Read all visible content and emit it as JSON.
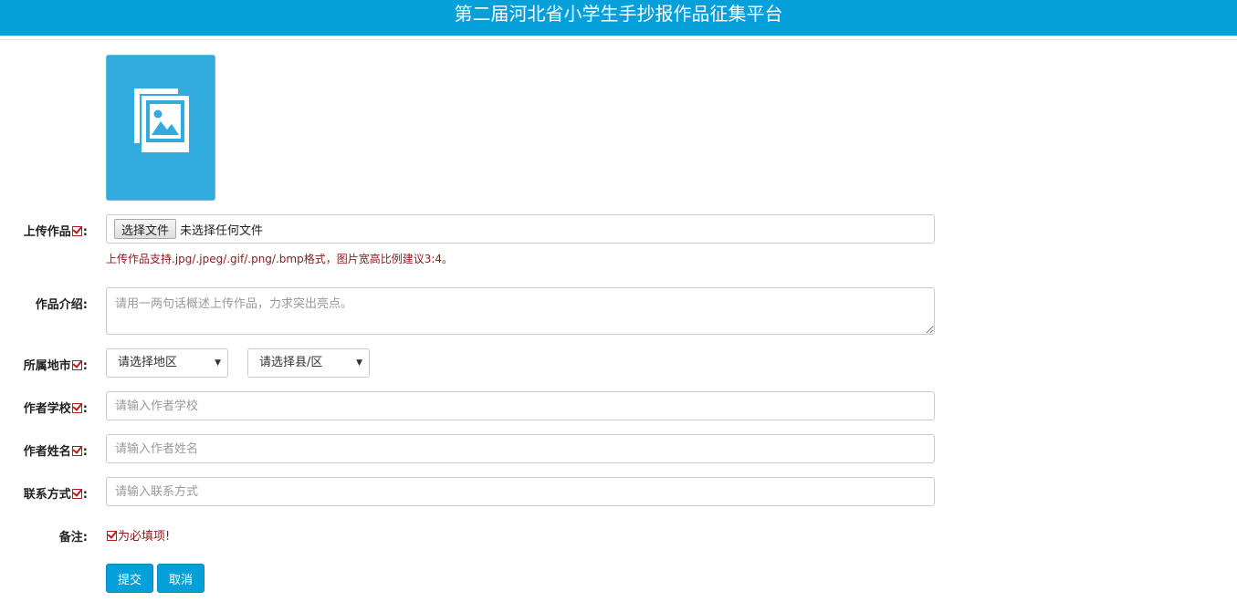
{
  "header": {
    "title": "第二届河北省小学生手抄报作品征集平台"
  },
  "colors": {
    "header": "#059fd9",
    "preview": "#32acdf",
    "required": "#b71c1c",
    "button": "#059fd9"
  },
  "preview": {
    "icon": "image-placeholder-icon"
  },
  "form": {
    "upload": {
      "label": "上传作品",
      "colon": ":",
      "button_label": "选择文件",
      "status": "未选择任何文件",
      "hint": "上传作品支持.jpg/.jpeg/.gif/.png/.bmp格式，图片宽高比例建议3:4。"
    },
    "intro": {
      "label": "作品介绍:",
      "placeholder": "请用一两句话概述上传作品，力求突出亮点。"
    },
    "region": {
      "label": "所属地市",
      "colon": ":",
      "city_placeholder": "请选择地区",
      "county_placeholder": "请选择县/区"
    },
    "school": {
      "label": "作者学校",
      "colon": ":",
      "placeholder": "请输入作者学校"
    },
    "name": {
      "label": "作者姓名",
      "colon": ":",
      "placeholder": "请输入作者姓名"
    },
    "contact": {
      "label": "联系方式",
      "colon": ":",
      "placeholder": "请输入联系方式"
    },
    "remark": {
      "label": "备注:",
      "text": "为必填项!"
    }
  },
  "actions": {
    "submit_label": "提交",
    "cancel_label": "取消"
  }
}
